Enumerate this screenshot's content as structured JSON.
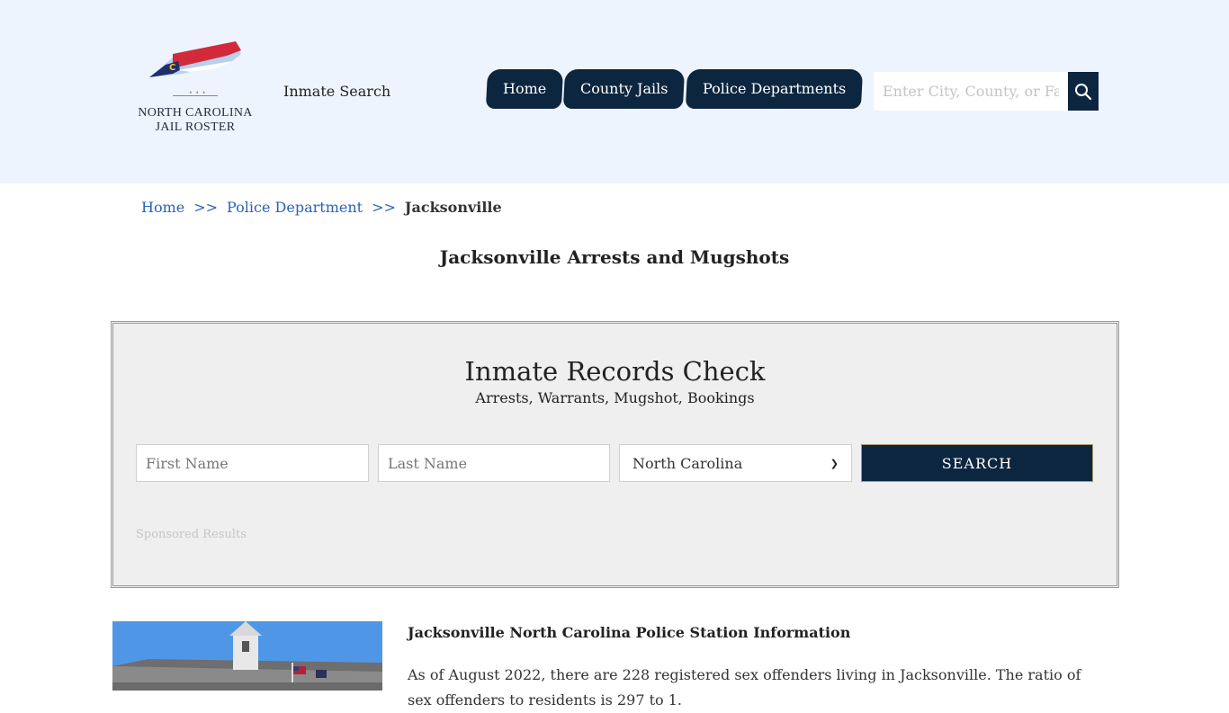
{
  "header": {
    "logo_line1": "NORTH CAROLINA",
    "logo_line2": "JAIL ROSTER",
    "inmate_search_label": "Inmate Search",
    "nav": [
      {
        "label": "Home"
      },
      {
        "label": "County Jails"
      },
      {
        "label": "Police Departments"
      }
    ],
    "search_placeholder": "Enter City, County, or Facility"
  },
  "breadcrumb": {
    "home": "Home",
    "sep1": ">>",
    "police": "Police Department",
    "sep2": ">>",
    "current": "Jacksonville"
  },
  "page_title": "Jacksonville Arrests and Mugshots",
  "records": {
    "title": "Inmate Records Check",
    "subtitle": "Arrests, Warrants, Mugshot, Bookings",
    "first_placeholder": "First Name",
    "last_placeholder": "Last Name",
    "state_value": "North Carolina",
    "search_label": "SEARCH",
    "sponsored": "Sponsored Results"
  },
  "info": {
    "title": "Jacksonville North Carolina Police Station Information",
    "text": "As of August 2022, there are 228 registered sex offenders living in Jacksonville. The ratio of sex offenders to residents is 297 to 1."
  },
  "colors": {
    "header_bg": "#eef4fd",
    "nav_bg": "#0d2640",
    "link": "#2a62b8",
    "panel_bg": "#efefef"
  }
}
